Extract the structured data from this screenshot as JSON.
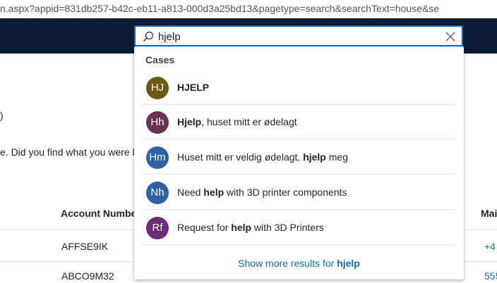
{
  "address_bar": {
    "url_text": "n.aspx?appid=831db257-b42c-eb11-a813-000d3a25bd13&pagetype=search&searchText=house&se"
  },
  "background": {
    "paren_text": ")",
    "message": "e. Did you find what you were l",
    "table": {
      "columns": [
        "Account Numbe",
        "Mai"
      ],
      "rows": [
        {
          "account": "AFFSE9IK",
          "phone": "+4"
        },
        {
          "account": "ABCO9M32",
          "phone": "555"
        }
      ]
    }
  },
  "search": {
    "value": "hjelp",
    "placeholder": "",
    "icon": "search-icon",
    "clear_icon": "close-icon"
  },
  "dropdown": {
    "section_title": "Cases",
    "results": [
      {
        "initials": "HJ",
        "color": "#6b5a12",
        "pre": "",
        "bold": "HJELP",
        "post": ""
      },
      {
        "initials": "Hh",
        "color": "#6b2f50",
        "pre": "",
        "bold": "Hjelp",
        "post": ", huset mitt er ødelagt"
      },
      {
        "initials": "Hm",
        "color": "#2e62a6",
        "pre": "Huset mitt er veldig ødelagt, ",
        "bold": "hjelp",
        "post": " meg"
      },
      {
        "initials": "Nh",
        "color": "#2e62a6",
        "pre": "Need ",
        "bold": "help",
        "post": " with 3D printer components"
      },
      {
        "initials": "Rf",
        "color": "#6b2a7a",
        "pre": "Request for ",
        "bold": "help",
        "post": " with 3D Printers"
      }
    ],
    "show_more_prefix": "Show more results for ",
    "show_more_query": "hjelp"
  }
}
